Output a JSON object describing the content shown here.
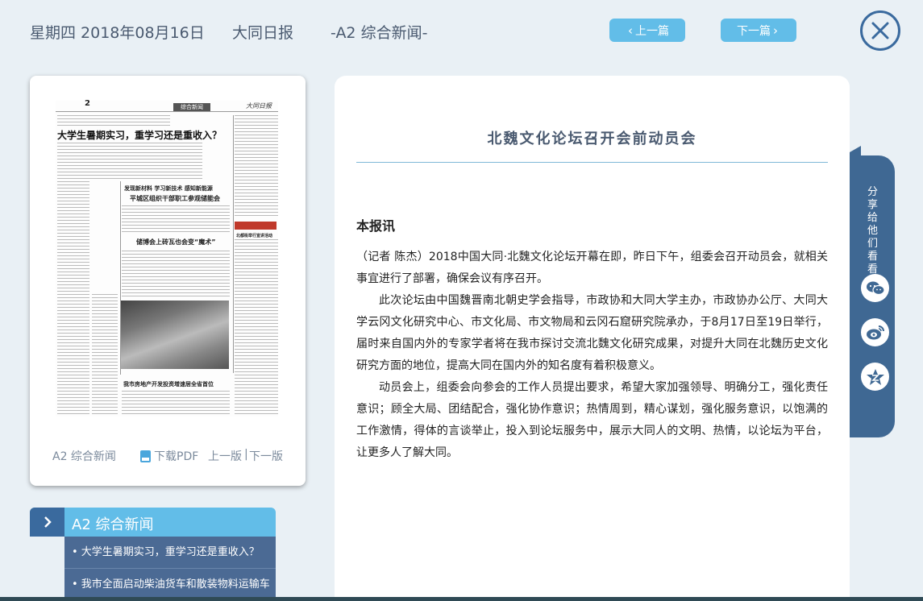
{
  "header": {
    "date": "星期四 2018年08月16日",
    "paper": "大同日报",
    "section": "-A2 综合新闻-",
    "prev_label": "上一篇",
    "next_label": "下一篇"
  },
  "page_card": {
    "thumb": {
      "page_number": "2",
      "section_box": "综合新闻",
      "logo": "大同日报",
      "headline": "大学生暑期实习，重学习还是重收入？",
      "sub1": "发现新材料  学习新技术  感知新能源",
      "sub2": "平城区组织干部职工参观储能会",
      "sub3": "储博会上砖瓦也会变“魔术”",
      "sub4": "我市房地产开发投资增速居全省首位",
      "sub5": "北都街举行宣讲活动"
    },
    "footer": {
      "section": "A2 综合新闻",
      "pdf": "下载PDF",
      "prev": "上一版",
      "sep": "|",
      "next": "下一版"
    }
  },
  "section_list": {
    "title": "A2  综合新闻",
    "items": [
      "• 大学生暑期实习，重学习还是重收入？",
      "• 我市全面启动柴油货车和散装物料运输车"
    ]
  },
  "article": {
    "title": "北魏文化论坛召开会前动员会",
    "lead": "本报讯",
    "paragraphs": [
      "（记者 陈杰）2018中国大同·北魏文化论坛开幕在即，昨日下午，组委会召开动员会，就相关事宜进行了部署，确保会议有序召开。",
      "此次论坛由中国魏晋南北朝史学会指导，市政协和大同大学主办，市政协办公厅、大同大学云冈文化研究中心、市文化局、市文物局和云冈石窟研究院承办，于8月17日至19日举行，届时来自国内外的专家学者将在我市探讨交流北魏文化研究成果，对提升大同在北魏历史文化研究方面的地位，提高大同在国内外的知名度有着积极意义。",
      "动员会上，组委会向参会的工作人员提出要求，希望大家加强领导、明确分工，强化责任意识；顾全大局、团结配合，强化协作意识；热情周到，精心谋划，强化服务意识，以饱满的工作激情，得体的言谈举止，投入到论坛服务中，展示大同人的文明、热情，以论坛为平台，让更多人了解大同。"
    ]
  },
  "share": {
    "label": "分享给他们看看",
    "icons": [
      "wechat-icon",
      "weibo-icon",
      "qzone-icon"
    ]
  },
  "colors": {
    "accent": "#62bde8",
    "dark_blue": "#3a6a9e",
    "background": "#e9f0f5"
  }
}
